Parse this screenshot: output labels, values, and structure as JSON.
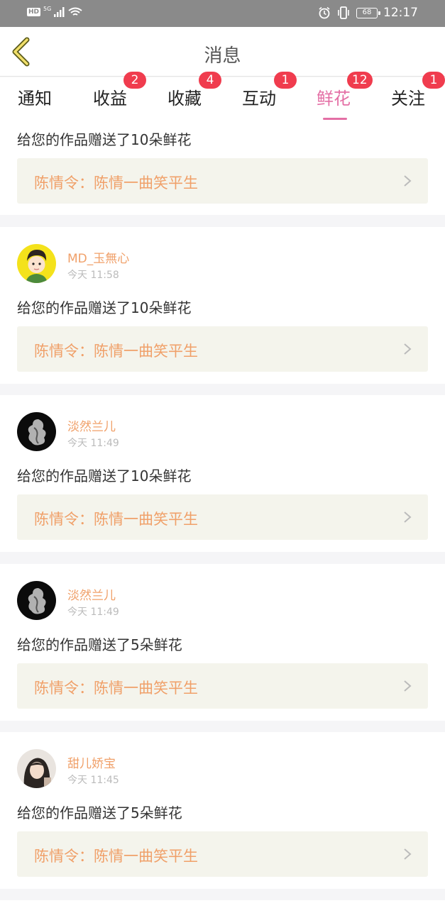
{
  "status_bar": {
    "hd": "HD",
    "network": "5G",
    "battery": "68",
    "time": "12:17"
  },
  "header": {
    "title": "消息",
    "back_icon": "back-chevron-icon"
  },
  "tabs": [
    {
      "label": "通知",
      "badge": ""
    },
    {
      "label": "收益",
      "badge": "2"
    },
    {
      "label": "收藏",
      "badge": "4"
    },
    {
      "label": "互动",
      "badge": "1"
    },
    {
      "label": "鲜花",
      "badge": "12",
      "active": true
    },
    {
      "label": "关注",
      "badge": "1"
    }
  ],
  "messages": [
    {
      "user": "",
      "time": "",
      "text": "给您的作品赠送了10朵鲜花",
      "work": "陈情令：陈情一曲笑平生"
    },
    {
      "user": "MD_玉無心",
      "time": "今天 11:58",
      "text": "给您的作品赠送了10朵鲜花",
      "work": "陈情令：陈情一曲笑平生"
    },
    {
      "user": "淡然兰儿",
      "time": "今天 11:49",
      "text": "给您的作品赠送了10朵鲜花",
      "work": "陈情令：陈情一曲笑平生"
    },
    {
      "user": "淡然兰儿",
      "time": "今天 11:49",
      "text": "给您的作品赠送了5朵鲜花",
      "work": "陈情令：陈情一曲笑平生"
    },
    {
      "user": "甜儿娇宝",
      "time": "今天 11:45",
      "text": "给您的作品赠送了5朵鲜花",
      "work": "陈情令：陈情一曲笑平生"
    }
  ],
  "colors": {
    "accent": "#e46fa5",
    "badge": "#f03c4e",
    "username": "#f0a069",
    "work_bg": "#f4f4ec"
  }
}
